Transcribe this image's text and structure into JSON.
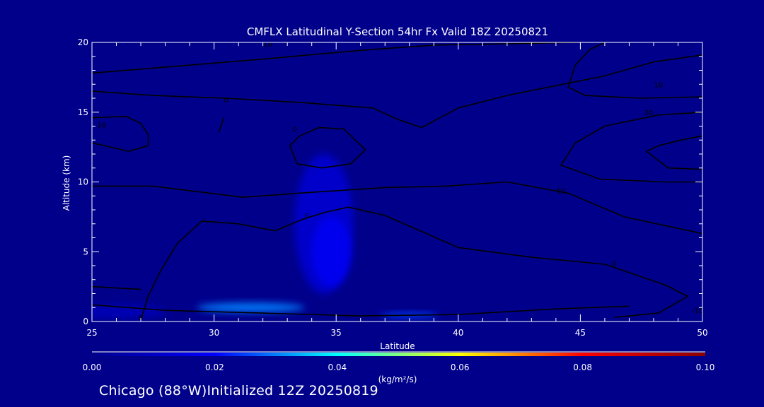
{
  "chart_data": {
    "type": "heatmap",
    "title": "CMFLX Latitudinal Y-Section 54hr  Fx Valid 18Z 20250821",
    "xlabel": "Latitude",
    "ylabel": "Altitude (km)",
    "xlim": [
      25,
      50
    ],
    "ylim": [
      0,
      20
    ],
    "x_major_ticks": [
      25,
      30,
      35,
      40,
      45,
      50
    ],
    "x_minor_step": 1,
    "y_major_ticks": [
      0,
      5,
      10,
      15,
      20
    ],
    "y_minor_step": 1,
    "colorbar": {
      "label": "(kg/m²/s)",
      "range": [
        0,
        0.1
      ],
      "ticks": [
        "0.00",
        "0.02",
        "0.04",
        "0.06",
        "0.08",
        "0.10"
      ],
      "colormap": [
        "#00008b",
        "#0000ff",
        "#00ffff",
        "#ffff00",
        "#ff0000",
        "#8b0000"
      ]
    },
    "flux_regions": [
      {
        "lat": 34.5,
        "alt": 7.0,
        "lat_half_width": 1.2,
        "alt_half_height": 5.0,
        "value": 0.012
      },
      {
        "lat": 34.8,
        "alt": 5.0,
        "lat_half_width": 0.8,
        "alt_half_height": 2.5,
        "value": 0.018
      },
      {
        "lat": 31.5,
        "alt": 1.0,
        "lat_half_width": 2.2,
        "alt_half_height": 0.35,
        "value": 0.03
      },
      {
        "lat": 38.0,
        "alt": 0.45,
        "lat_half_width": 1.2,
        "alt_half_height": 0.2,
        "value": 0.025
      },
      {
        "lat": 26.0,
        "alt": 0.7,
        "lat_half_width": 2.0,
        "alt_half_height": 0.5,
        "value": 0.008
      }
    ],
    "contours": [
      {
        "level": "0",
        "points": [
          [
            27.0,
            0.1
          ],
          [
            27.3,
            1.8
          ],
          [
            27.8,
            3.6
          ],
          [
            28.5,
            5.6
          ],
          [
            29.5,
            7.2
          ],
          [
            31,
            7.0
          ],
          [
            32.5,
            6.5
          ],
          [
            33.6,
            7.3
          ],
          [
            34.5,
            7.8
          ],
          [
            35.5,
            8.2
          ],
          [
            37,
            7.6
          ],
          [
            40,
            5.3
          ],
          [
            43,
            4.6
          ],
          [
            46,
            4.1
          ],
          [
            48.5,
            2.6
          ],
          [
            49.4,
            1.8
          ],
          [
            48.2,
            0.6
          ],
          [
            46.4,
            0.3
          ]
        ],
        "labels": [
          [
            27.0,
            0.3
          ],
          [
            33.8,
            7.6
          ],
          [
            46.4,
            4.2
          ]
        ]
      },
      {
        "level": "10",
        "points": [
          [
            25,
            9.7
          ],
          [
            27.5,
            9.7
          ],
          [
            31.2,
            8.9
          ],
          [
            33.5,
            9.2
          ],
          [
            37,
            9.6
          ],
          [
            39.5,
            9.7
          ],
          [
            42,
            10.0
          ],
          [
            44.5,
            9.2
          ],
          [
            46.8,
            7.5
          ],
          [
            48.4,
            6.9
          ],
          [
            50,
            6.3
          ]
        ],
        "labels": [
          [
            44.2,
            9.4
          ]
        ]
      },
      {
        "level": "10",
        "points": [
          [
            25,
            14.6
          ],
          [
            26.4,
            14.7
          ],
          [
            27.0,
            14.2
          ],
          [
            27.3,
            13.4
          ],
          [
            27.3,
            12.6
          ],
          [
            26.5,
            12.2
          ],
          [
            25,
            12.8
          ]
        ],
        "labels": [
          [
            25.4,
            14.1
          ]
        ]
      },
      {
        "level": "0",
        "points": [
          [
            33.5,
            13.3
          ],
          [
            34.3,
            13.9
          ],
          [
            35.3,
            13.8
          ],
          [
            36.2,
            12.3
          ],
          [
            35.6,
            11.3
          ],
          [
            34.4,
            11.0
          ],
          [
            33.4,
            11.3
          ],
          [
            33.1,
            12.6
          ],
          [
            33.5,
            13.3
          ]
        ],
        "labels": [
          [
            33.3,
            13.8
          ]
        ]
      },
      {
        "level": "0",
        "points": [
          [
            30.3,
            14.1
          ],
          [
            30.4,
            14.6
          ],
          [
            30.2,
            13.6
          ],
          [
            30.3,
            14.1
          ]
        ],
        "labels": []
      },
      {
        "level": "0",
        "points": [
          [
            25,
            16.5
          ],
          [
            27.5,
            16.2
          ],
          [
            30.5,
            16.0
          ],
          [
            33.5,
            15.7
          ],
          [
            36.5,
            15.3
          ],
          [
            37.5,
            14.5
          ],
          [
            38.5,
            13.9
          ],
          [
            40,
            15.3
          ],
          [
            42,
            16.2
          ],
          [
            44,
            16.9
          ],
          [
            46,
            17.6
          ],
          [
            48,
            18.6
          ],
          [
            50,
            19.1
          ]
        ],
        "labels": [
          [
            30.5,
            15.9
          ]
        ]
      },
      {
        "level": "10",
        "points": [
          [
            25,
            17.8
          ],
          [
            28.5,
            18.3
          ],
          [
            32,
            18.8
          ],
          [
            34.5,
            19.2
          ],
          [
            36.5,
            19.5
          ],
          [
            39,
            19.8
          ],
          [
            42,
            19.9
          ],
          [
            45,
            20.0
          ]
        ],
        "labels": [
          [
            32.2,
            19.9
          ]
        ]
      },
      {
        "level": "10",
        "points": [
          [
            46,
            20.0
          ],
          [
            45.4,
            19.5
          ],
          [
            44.8,
            18.4
          ],
          [
            44.5,
            16.8
          ],
          [
            45.2,
            16.2
          ],
          [
            47.5,
            16.0
          ],
          [
            50,
            16.1
          ]
        ],
        "labels": [
          [
            48.2,
            17.0
          ]
        ]
      },
      {
        "level": "20",
        "points": [
          [
            50,
            15.0
          ],
          [
            48.2,
            14.8
          ],
          [
            46.0,
            14.0
          ],
          [
            44.8,
            12.8
          ],
          [
            44.2,
            11.2
          ],
          [
            45.8,
            10.2
          ],
          [
            48.5,
            10.0
          ],
          [
            50,
            10.0
          ]
        ],
        "labels": [
          [
            47.8,
            15.0
          ]
        ]
      },
      {
        "level": "30",
        "points": [
          [
            50,
            13.3
          ],
          [
            49.1,
            13.0
          ],
          [
            48.2,
            12.6
          ],
          [
            47.7,
            12.2
          ],
          [
            48.6,
            11.0
          ],
          [
            50,
            10.9
          ]
        ],
        "labels": []
      },
      {
        "level": "-10",
        "points": [
          [
            25,
            1.2
          ],
          [
            28,
            0.8
          ],
          [
            32,
            0.6
          ],
          [
            36,
            0.4
          ],
          [
            40,
            0.5
          ],
          [
            44,
            0.9
          ],
          [
            47,
            1.1
          ]
        ],
        "labels": [
          [
            49.8,
            0.8
          ]
        ]
      },
      {
        "level": "0",
        "points": [
          [
            25,
            2.5
          ],
          [
            27,
            2.3
          ]
        ],
        "labels": []
      }
    ]
  },
  "caption": "Chicago (88°W)Initialized 12Z 20250819"
}
